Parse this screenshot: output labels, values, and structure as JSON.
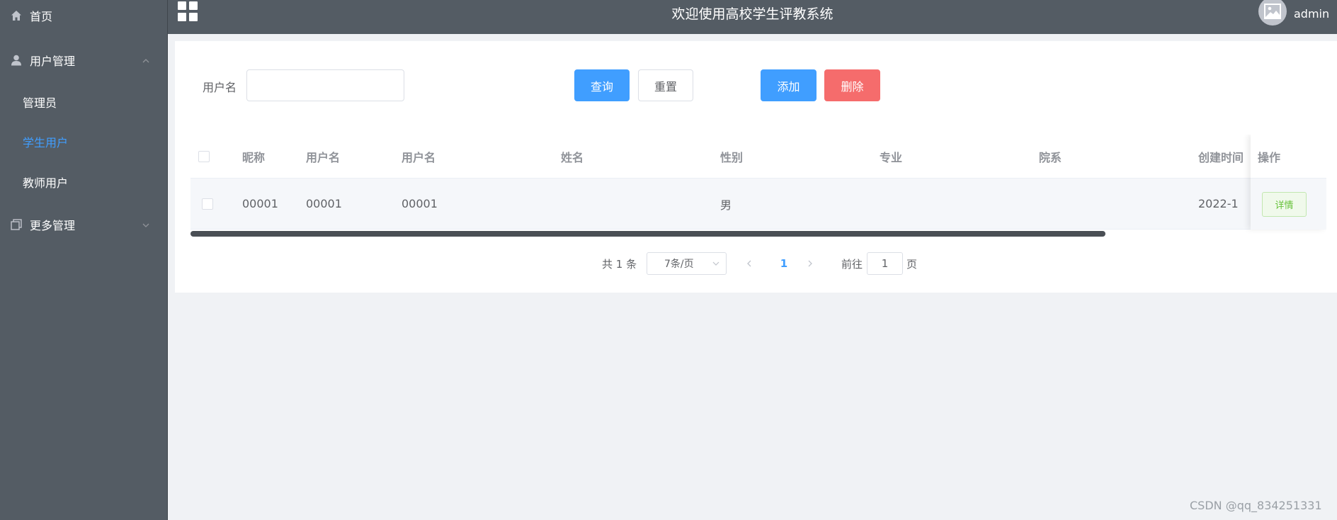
{
  "sidebar": {
    "items": [
      {
        "label": "首页",
        "icon": "home-icon"
      },
      {
        "label": "用户管理",
        "icon": "user-icon"
      },
      {
        "label": "更多管理",
        "icon": "copy-icon"
      }
    ],
    "sub_items": [
      {
        "label": "管理员"
      },
      {
        "label": "学生用户"
      },
      {
        "label": "教师用户"
      }
    ],
    "active_sub": "学生用户"
  },
  "header": {
    "title": "欢迎使用高校学生评教系统",
    "username": "admin"
  },
  "search": {
    "label": "用户名",
    "value": "",
    "query_label": "查询",
    "reset_label": "重置",
    "add_label": "添加",
    "delete_label": "删除"
  },
  "table": {
    "headers": [
      "昵称",
      "用户名",
      "用户名",
      "姓名",
      "性别",
      "专业",
      "院系",
      "创建时间"
    ],
    "action_header": "操作",
    "rows": [
      {
        "cells": [
          "00001",
          "00001",
          "00001",
          "",
          "男",
          "",
          "",
          "2022-1"
        ],
        "action": "详情"
      }
    ]
  },
  "pagination": {
    "total_text": "共 1 条",
    "page_size": "7条/页",
    "current_page": "1",
    "goto_label": "前往",
    "goto_value": "1",
    "page_unit": "页"
  },
  "watermark": "CSDN @qq_834251331",
  "colors": {
    "sidebar_bg": "#545c64",
    "primary": "#409eff",
    "danger": "#f56c6c",
    "success": "#67c23a"
  }
}
